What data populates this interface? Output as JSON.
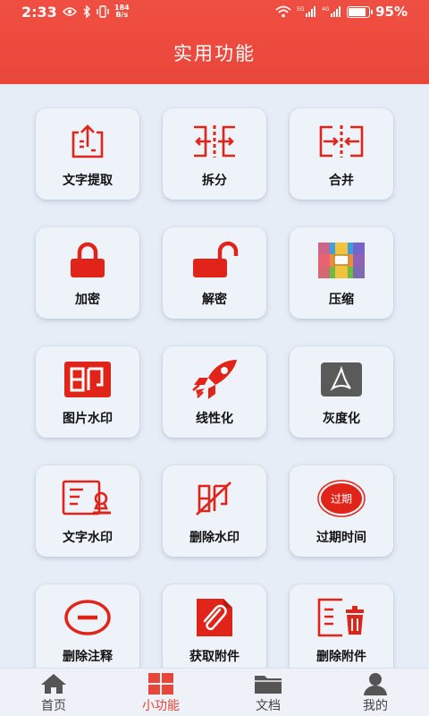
{
  "status_bar": {
    "time": "2:33",
    "speed_value": "184",
    "speed_unit": "B/s",
    "battery_pct": "95%"
  },
  "header": {
    "title": "实用功能"
  },
  "features": [
    {
      "label": "文字提取",
      "icon": "text-extract-icon"
    },
    {
      "label": "拆分",
      "icon": "split-icon"
    },
    {
      "label": "合并",
      "icon": "merge-icon"
    },
    {
      "label": "加密",
      "icon": "lock-icon"
    },
    {
      "label": "解密",
      "icon": "unlock-icon"
    },
    {
      "label": "压缩",
      "icon": "archive-icon"
    },
    {
      "label": "图片水印",
      "icon": "image-stamp-icon"
    },
    {
      "label": "线性化",
      "icon": "rocket-icon"
    },
    {
      "label": "灰度化",
      "icon": "grayscale-pdf-icon"
    },
    {
      "label": "文字水印",
      "icon": "text-watermark-icon"
    },
    {
      "label": "删除水印",
      "icon": "remove-watermark-icon"
    },
    {
      "label": "过期时间",
      "icon": "expire-icon",
      "badge": "过期"
    },
    {
      "label": "删除注释",
      "icon": "remove-annotation-icon"
    },
    {
      "label": "获取附件",
      "icon": "attachment-icon"
    },
    {
      "label": "删除附件",
      "icon": "delete-attachment-icon"
    }
  ],
  "tabs": [
    {
      "label": "首页",
      "icon": "home-icon",
      "active": false
    },
    {
      "label": "小功能",
      "icon": "grid-icon",
      "active": true
    },
    {
      "label": "文档",
      "icon": "folder-icon",
      "active": false
    },
    {
      "label": "我的",
      "icon": "user-icon",
      "active": false
    }
  ],
  "colors": {
    "accent": "#e8463a",
    "header": "#ea473b",
    "background": "#e6edf6"
  }
}
